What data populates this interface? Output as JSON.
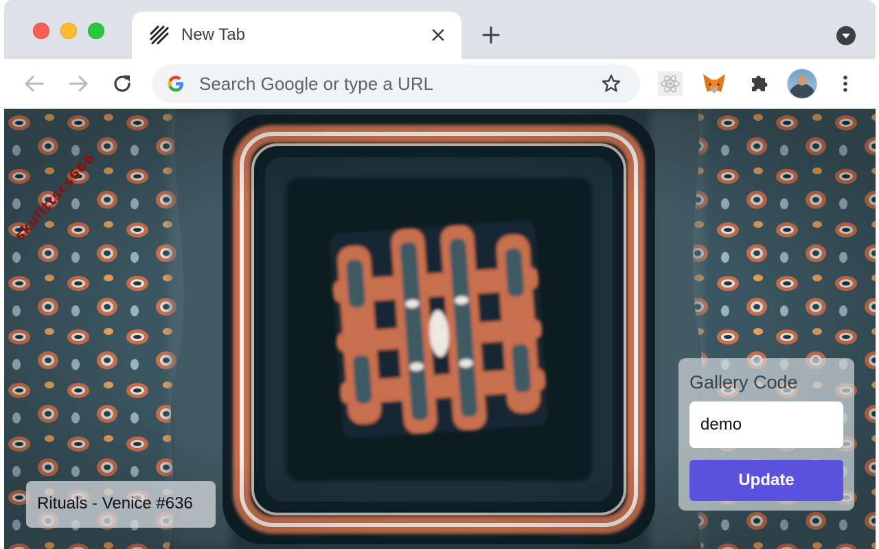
{
  "browser": {
    "tab": {
      "title": "New Tab"
    },
    "omnibox": {
      "placeholder": "Search Google or type a URL"
    }
  },
  "artwork": {
    "signature": "skullttscs666",
    "caption": "Rituals - Venice #636"
  },
  "gallery": {
    "label": "Gallery Code",
    "input_value": "demo",
    "button_label": "Update"
  },
  "colors": {
    "accent_button": "#5c52e0",
    "art_orange": "#c8704e",
    "art_teal": "#3b5660",
    "art_dark": "#0c1a24"
  }
}
